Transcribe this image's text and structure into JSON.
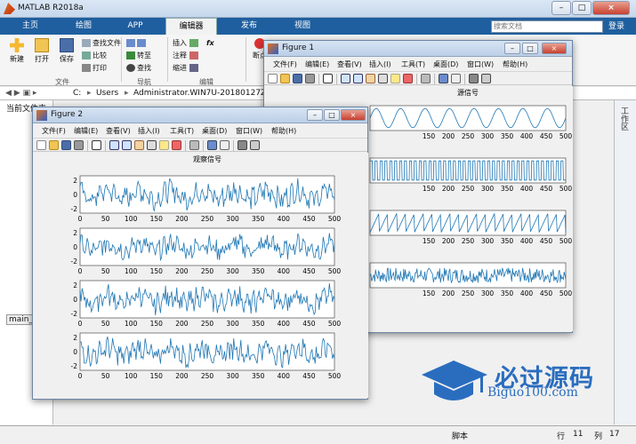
{
  "app": {
    "title": "MATLAB R2018a",
    "search_placeholder": "搜索文档",
    "login_label": "登录",
    "help_icon": "help-icon",
    "minimize_label": "–",
    "maximize_label": "□",
    "close_label": "×"
  },
  "ribbon_tabs": [
    "主页",
    "绘图",
    "APP",
    "编辑器",
    "发布",
    "视图"
  ],
  "ribbon": {
    "new": "新建",
    "open": "打开",
    "save": "保存",
    "find_files": "查找文件",
    "compare": "比较",
    "print": "打印",
    "goto": "转至",
    "find": "查找",
    "insert": "插入",
    "comment": "注释",
    "indent": "缩进",
    "fx": "fx",
    "breakpoint": "断点",
    "group_file": "文件",
    "group_nav": "导航",
    "group_edit": "编辑"
  },
  "address": {
    "path": [
      "C:",
      "Users",
      "Administrator.WIN7U-20180127Z"
    ]
  },
  "panels": {
    "current_folder": "当前文件夹",
    "main_file": "main_ic",
    "workspace": "工作区"
  },
  "status": {
    "script": "脚本",
    "row_label": "行",
    "row": "11",
    "col_label": "列",
    "col": "17"
  },
  "watermark": {
    "cn": "必过源码",
    "en": "Biguo100.com"
  },
  "figure1": {
    "title": "Figure 1",
    "menus": [
      "文件(F)",
      "编辑(E)",
      "查看(V)",
      "插入(I)",
      "工具(T)",
      "桌面(D)",
      "窗口(W)",
      "帮助(H)"
    ],
    "plot_title": "源信号"
  },
  "figure2": {
    "title": "Figure 2",
    "menus": [
      "文件(F)",
      "编辑(E)",
      "查看(V)",
      "插入(I)",
      "工具(T)",
      "桌面(D)",
      "窗口(W)",
      "帮助(H)"
    ],
    "plot_title": "观察信号"
  },
  "chart_data": [
    {
      "type": "line",
      "title": "源信号",
      "figure": "Figure 1",
      "x_range": [
        0,
        500
      ],
      "x_ticks": [
        150,
        200,
        250,
        300,
        350,
        400,
        450,
        500
      ],
      "series": [
        {
          "shape": "sine",
          "periods_per_500": 8,
          "amplitude": 1
        },
        {
          "shape": "square",
          "periods_per_500": 40,
          "amplitude": 1
        },
        {
          "shape": "sawtooth",
          "periods_per_500": 22,
          "amplitude": 1
        },
        {
          "shape": "noise",
          "amplitude": 3
        }
      ],
      "color": "#1f77b4"
    },
    {
      "type": "line",
      "title": "观察信号",
      "figure": "Figure 2",
      "x_range": [
        0,
        500
      ],
      "x_ticks": [
        0,
        50,
        100,
        150,
        200,
        250,
        300,
        350,
        400,
        450,
        500
      ],
      "y_ticks": [
        2,
        0,
        -2
      ],
      "series": [
        {
          "shape": "mixture",
          "amplitude": 2.5
        },
        {
          "shape": "mixture",
          "amplitude": 2.2
        },
        {
          "shape": "mixture",
          "amplitude": 2.5
        },
        {
          "shape": "mixture",
          "amplitude": 2.5
        }
      ],
      "color": "#1f77b4"
    }
  ]
}
